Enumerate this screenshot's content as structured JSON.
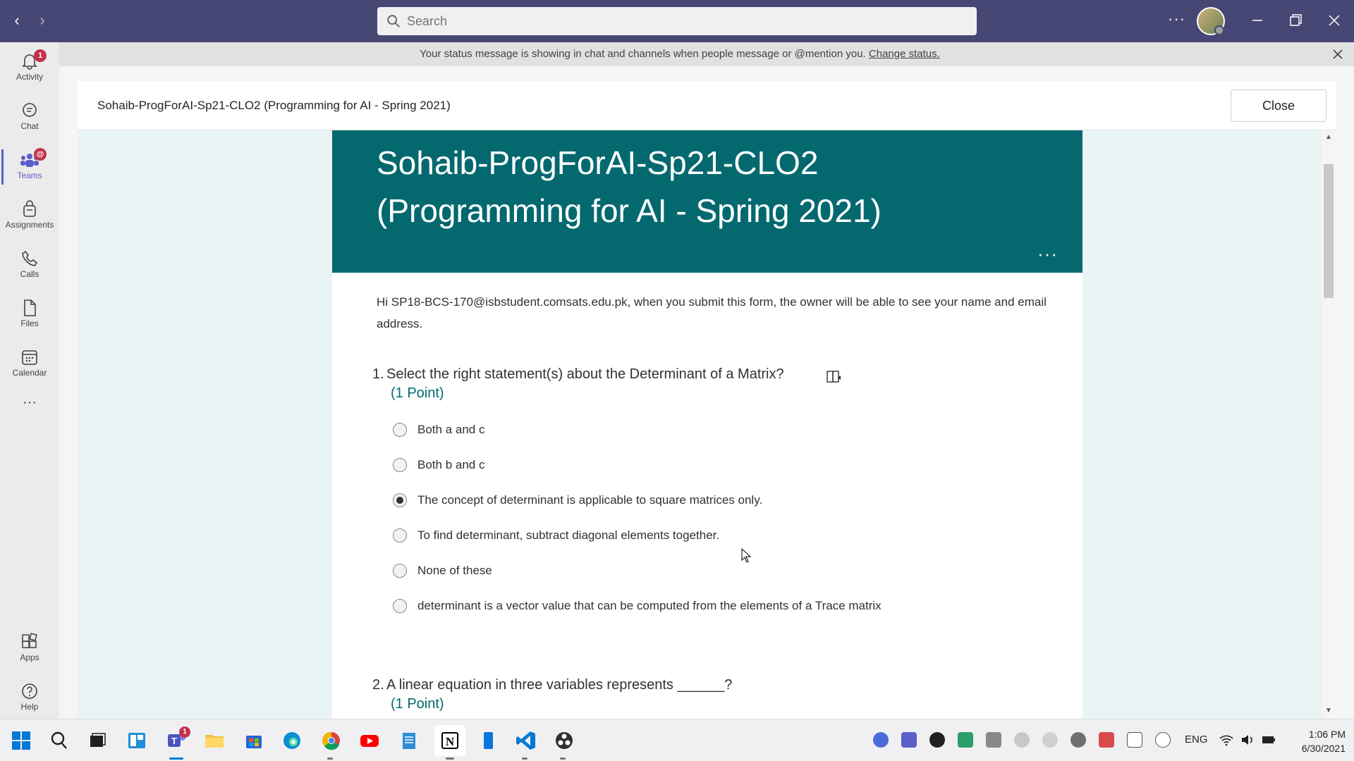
{
  "titlebar": {
    "search_placeholder": "Search",
    "more_label": "···"
  },
  "rail": {
    "items": [
      {
        "label": "Activity",
        "icon": "bell-icon",
        "badge": "1"
      },
      {
        "label": "Chat",
        "icon": "chat-icon"
      },
      {
        "label": "Teams",
        "icon": "teams-icon",
        "badge": "@",
        "active": true
      },
      {
        "label": "Assignments",
        "icon": "assignments-icon"
      },
      {
        "label": "Calls",
        "icon": "phone-icon"
      },
      {
        "label": "Files",
        "icon": "file-icon"
      },
      {
        "label": "Calendar",
        "icon": "calendar-icon"
      }
    ],
    "more_label": "···",
    "bottom": [
      {
        "label": "Apps",
        "icon": "apps-icon"
      },
      {
        "label": "Help",
        "icon": "help-icon"
      }
    ]
  },
  "banner": {
    "message": "Your status message is showing in chat and channels when people message or @mention you.",
    "link": "Change status."
  },
  "dialog": {
    "title": "Sohaib-ProgForAI-Sp21-CLO2 (Programming for AI - Spring 2021)",
    "close_label": "Close"
  },
  "form": {
    "title_line1": "Sohaib-ProgForAI-Sp21-CLO2",
    "title_line2": "(Programming for AI - Spring 2021)",
    "more_label": "···",
    "intro": "Hi SP18-BCS-170@isbstudent.comsats.edu.pk, when you submit this form, the owner will be able to see your name and email address.",
    "questions": [
      {
        "number": "1.",
        "text": "Select the right statement(s) about the Determinant of a Matrix?",
        "points": "(1 Point)",
        "options": [
          {
            "label": "Both a and c",
            "checked": false
          },
          {
            "label": "Both b and c",
            "checked": false
          },
          {
            "label": "The concept of determinant is applicable to square matrices only.",
            "checked": true
          },
          {
            "label": "To find determinant, subtract diagonal elements together.",
            "checked": false
          },
          {
            "label": "None of these",
            "checked": false
          },
          {
            "label": "determinant is a vector value that can be computed from the elements of a Trace matrix",
            "checked": false
          }
        ]
      },
      {
        "number": "2.",
        "text": "A linear equation in three variables represents ______?",
        "points": "(1 Point)"
      }
    ]
  },
  "taskbar": {
    "tray_lang": "ENG",
    "time": "1:06 PM",
    "date": "6/30/2021",
    "teams_badge": "1",
    "accent": "#464775",
    "form_theme": "#03696f"
  }
}
